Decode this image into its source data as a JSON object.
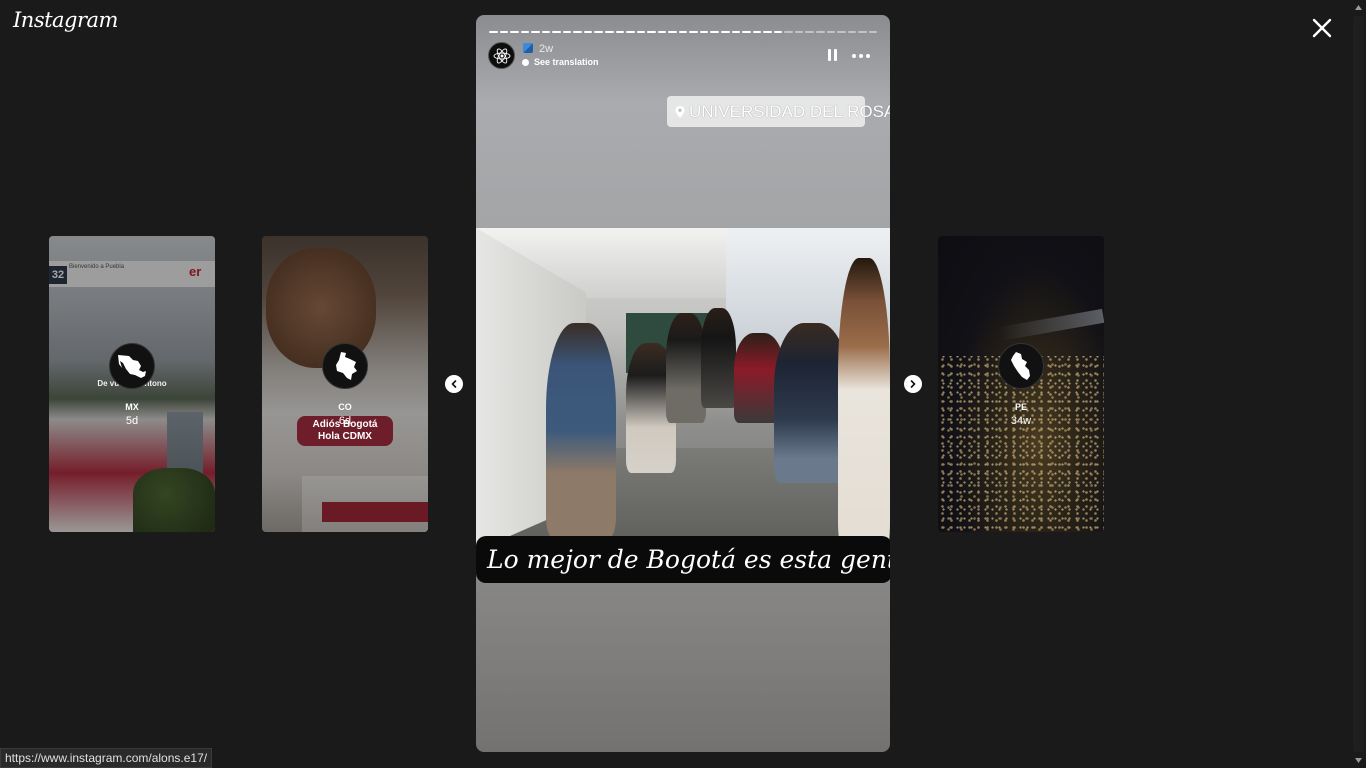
{
  "app": {
    "logo_text": "Instagram"
  },
  "close": {
    "icon": "close-icon"
  },
  "previews": [
    {
      "id": "mx",
      "username": "MX",
      "time": "5d",
      "avatar_icon": "mexico-map-icon",
      "banner_text": "Bienvenido a Puebla",
      "banner_number": "32",
      "banner_brand": "er",
      "caption": "De vuelta  pantono"
    },
    {
      "id": "co",
      "username": "CO",
      "time": "6d",
      "avatar_icon": "colombia-map-icon",
      "sticker_line1": "Adiós Bogotá",
      "sticker_line2": "Hola CDMX"
    },
    {
      "id": "pe",
      "username": "PE",
      "time": "34w",
      "avatar_icon": "peru-map-icon"
    }
  ],
  "story": {
    "time": "2w",
    "see_translation": "See translation",
    "location": "UNIVERSIDAD DEL ROSARIO",
    "caption": "Lo mejor de Bogotá es esta gente",
    "progress": {
      "segments": 37,
      "completed": 28
    },
    "avatar_icon": "atom-icon"
  },
  "status_bar": {
    "url": "https://www.instagram.com/alons.e17/"
  },
  "colors": {
    "background": "#1a1a1a",
    "text": "#ffffff",
    "caption_bg": "#0a0a0a",
    "sticker_maroon": "#6d1e2a"
  }
}
